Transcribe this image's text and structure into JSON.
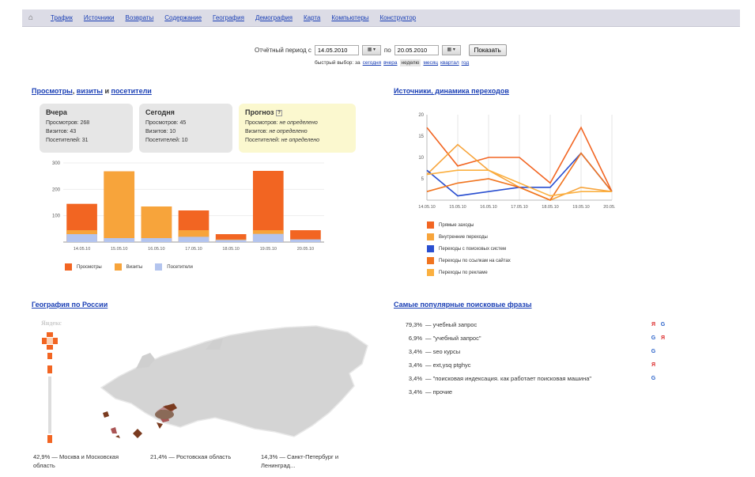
{
  "nav": {
    "home_icon": "home-icon",
    "items": [
      "Трафик",
      "Источники",
      "Возвраты",
      "Содержание",
      "География",
      "Демография",
      "Карта",
      "Компьютеры",
      "Конструктор"
    ]
  },
  "period": {
    "label_from": "Отчётный период с",
    "date_from": "14.05.2010",
    "label_to": "по",
    "date_to": "20.05.2010",
    "show_button": "Показать",
    "quick_label": "быстрый выбор: за",
    "quick_options": [
      "сегодня",
      "вчера",
      "неделю",
      "месяц",
      "квартал",
      "год"
    ],
    "quick_selected": "неделю"
  },
  "visits_section": {
    "title_part1": "Просмотры",
    "title_part2": "визиты",
    "title_and": "и",
    "title_part3": "посетители",
    "boxes": {
      "yesterday": {
        "title": "Вчера",
        "views": "Просмотров: 268",
        "visits": "Визитов: 43",
        "visitors": "Посетителей: 31"
      },
      "today": {
        "title": "Сегодня",
        "views": "Просмотров: 45",
        "visits": "Визитов: 10",
        "visitors": "Посетителей: 10"
      },
      "forecast": {
        "title": "Прогноз",
        "views_label": "Просмотров:",
        "views_value": "не определено",
        "visits_label": "Визитов:",
        "visits_value": "не определено",
        "visitors_label": "Посетителей:",
        "visitors_value": "не определено"
      }
    }
  },
  "chart_data": [
    {
      "type": "bar",
      "categories": [
        "14.05.10",
        "15.05.10",
        "16.05.10",
        "17.05.10",
        "18.05.10",
        "19.05.10",
        "20.05.10"
      ],
      "ylim": [
        0,
        300
      ],
      "yticks": [
        100,
        200,
        300
      ],
      "series": [
        {
          "name": "Просмотры",
          "color": "#f26522",
          "values": [
            145,
            268,
            135,
            120,
            30,
            270,
            45
          ]
        },
        {
          "name": "Визиты",
          "color": "#f7a43b",
          "values": [
            45,
            268,
            135,
            45,
            10,
            45,
            10
          ]
        },
        {
          "name": "Посетители",
          "color": "#b3c4ee",
          "values": [
            30,
            15,
            15,
            20,
            8,
            31,
            10
          ]
        }
      ]
    },
    {
      "type": "line",
      "title": "Источники, динамика переходов",
      "categories": [
        "14.05.10",
        "15.05.10",
        "16.05.10",
        "17.05.10",
        "18.05.10",
        "19.05.10",
        "20.05.10"
      ],
      "ylim": [
        0,
        20
      ],
      "yticks": [
        5,
        10,
        15,
        20
      ],
      "series": [
        {
          "name": "Прямые заходы",
          "color": "#f26522",
          "values": [
            17,
            8,
            10,
            10,
            4,
            17,
            2
          ]
        },
        {
          "name": "Внутренние переходы",
          "color": "#f7a43b",
          "values": [
            6,
            13,
            7,
            3,
            0,
            3,
            2
          ]
        },
        {
          "name": "Переходы с поисковых систем",
          "color": "#2a4fd0",
          "values": [
            7,
            1,
            2,
            3,
            3,
            11,
            2
          ]
        },
        {
          "name": "Переходы по ссылкам на сайтах",
          "color": "#f0741f",
          "values": [
            2,
            4,
            5,
            3,
            0,
            11,
            2
          ]
        },
        {
          "name": "Переходы по рекламе",
          "color": "#fbb040",
          "values": [
            6,
            7,
            7,
            4,
            1,
            2,
            2
          ]
        }
      ]
    }
  ],
  "geo_section": {
    "title": "География по России",
    "map_logo": "Яндекс",
    "legend": [
      {
        "pct": "42,9%",
        "region": "— Москва и Московская область"
      },
      {
        "pct": "21,4%",
        "region": "— Ростовская область"
      },
      {
        "pct": "14,3%",
        "region": "— Санкт-Петербург и Ленинград..."
      }
    ]
  },
  "phrases_section": {
    "title": "Самые популярные поисковые фразы",
    "rows": [
      {
        "pct": "79,3%",
        "text": "— учебный запрос",
        "engines": [
          "yandex",
          "google"
        ]
      },
      {
        "pct": "6,9%",
        "text": "— \"учебный запрос\"",
        "engines": [
          "google",
          "yandex"
        ]
      },
      {
        "pct": "3,4%",
        "text": "— seo курсы",
        "engines": [
          "google"
        ]
      },
      {
        "pct": "3,4%",
        "text": "— ext,ysq ptghyc",
        "engines": [
          "yandex"
        ]
      },
      {
        "pct": "3,4%",
        "text": "— \"поисковая индексация. как работает поисковая машина\"",
        "engines": [
          "google"
        ]
      },
      {
        "pct": "3,4%",
        "text": "— прочие",
        "engines": []
      }
    ]
  }
}
